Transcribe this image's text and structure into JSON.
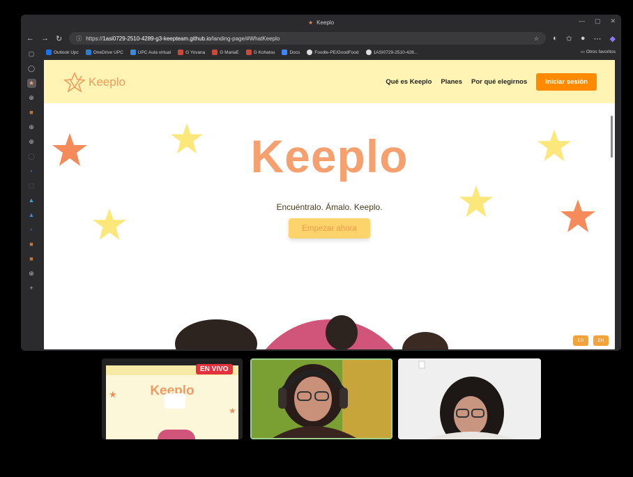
{
  "browser": {
    "tab_title": "Keeplo",
    "url_prefix": "https://",
    "url_host": "1asi0729-2510-4289-g3-keepteam.github.io",
    "url_path": "/landing-page/#WhatKeeplo",
    "bookmarks": [
      {
        "label": "Outlook Upc",
        "color": "#1a73e8"
      },
      {
        "label": "OneDrive UPC",
        "color": "#2b7cd3"
      },
      {
        "label": "UPC Aula virtual",
        "color": "#3c8ad8"
      },
      {
        "label": "G Yovana",
        "color": "#c94a3a"
      },
      {
        "label": "G MariaE",
        "color": "#c94a3a"
      },
      {
        "label": "G Kohatsu",
        "color": "#c94a3a"
      },
      {
        "label": "Docs",
        "color": "#4285f4"
      },
      {
        "label": "Foodle-PE/GoodFood",
        "color": "#dddddd"
      },
      {
        "label": "1ASI0729-2510-428...",
        "color": "#dddddd"
      }
    ],
    "other_favorites": "Otros favoritos"
  },
  "site": {
    "logo_text": "Keeplo",
    "nav": {
      "what": "Qué es Keeplo",
      "plans": "Planes",
      "why": "Por qué elegirnos",
      "login": "Iniciar sesión"
    },
    "hero": {
      "title": "Keeplo",
      "tagline": "Encuéntralo. Ámalo. Keeplo.",
      "cta": "Empezar ahora"
    },
    "lang_es": "ES",
    "lang_en": "EN"
  },
  "call": {
    "live_badge": "EN VIVO",
    "shared_title": "Keeplo"
  },
  "colors": {
    "header_bg": "#fff4b3",
    "accent_orange": "#ff8a00",
    "brand_peach": "#f5a06e",
    "star_yellow": "#fbe77a",
    "star_orange": "#f58a5a",
    "live_red": "#e3313e"
  }
}
